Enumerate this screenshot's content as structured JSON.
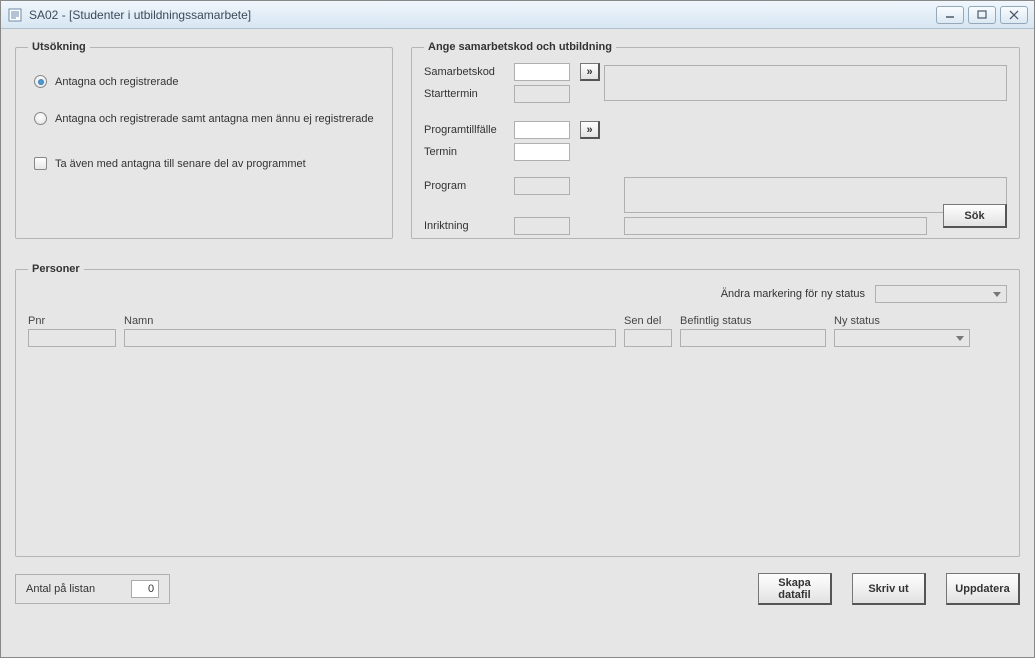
{
  "window": {
    "title": "SA02 - [Studenter i utbildningssamarbete]"
  },
  "utsokning": {
    "legend": "Utsökning",
    "radio1": "Antagna och registrerade",
    "radio2": "Antagna och registrerade samt antagna men ännu ej registrerade",
    "checkbox": "Ta även med antagna till senare del av programmet"
  },
  "ange": {
    "legend": "Ange samarbetskod och utbildning",
    "lbl_samarbetskod": "Samarbetskod",
    "lbl_starttermin": "Starttermin",
    "lbl_programtillfalle": "Programtillfälle",
    "lbl_termin": "Termin",
    "lbl_program": "Program",
    "lbl_inriktning": "Inriktning",
    "arrow_glyph": "»",
    "sok": "Sök"
  },
  "personer": {
    "legend": "Personer",
    "marker_label": "Ändra markering för ny status",
    "col_pnr": "Pnr",
    "col_namn": "Namn",
    "col_sendel": "Sen del",
    "col_befintlig": "Befintlig status",
    "col_nystatus": "Ny status"
  },
  "footer": {
    "antal_label": "Antal på listan",
    "antal_value": "0",
    "btn_skapa": "Skapa\ndatafil",
    "btn_skriv": "Skriv ut",
    "btn_uppdatera": "Uppdatera"
  }
}
